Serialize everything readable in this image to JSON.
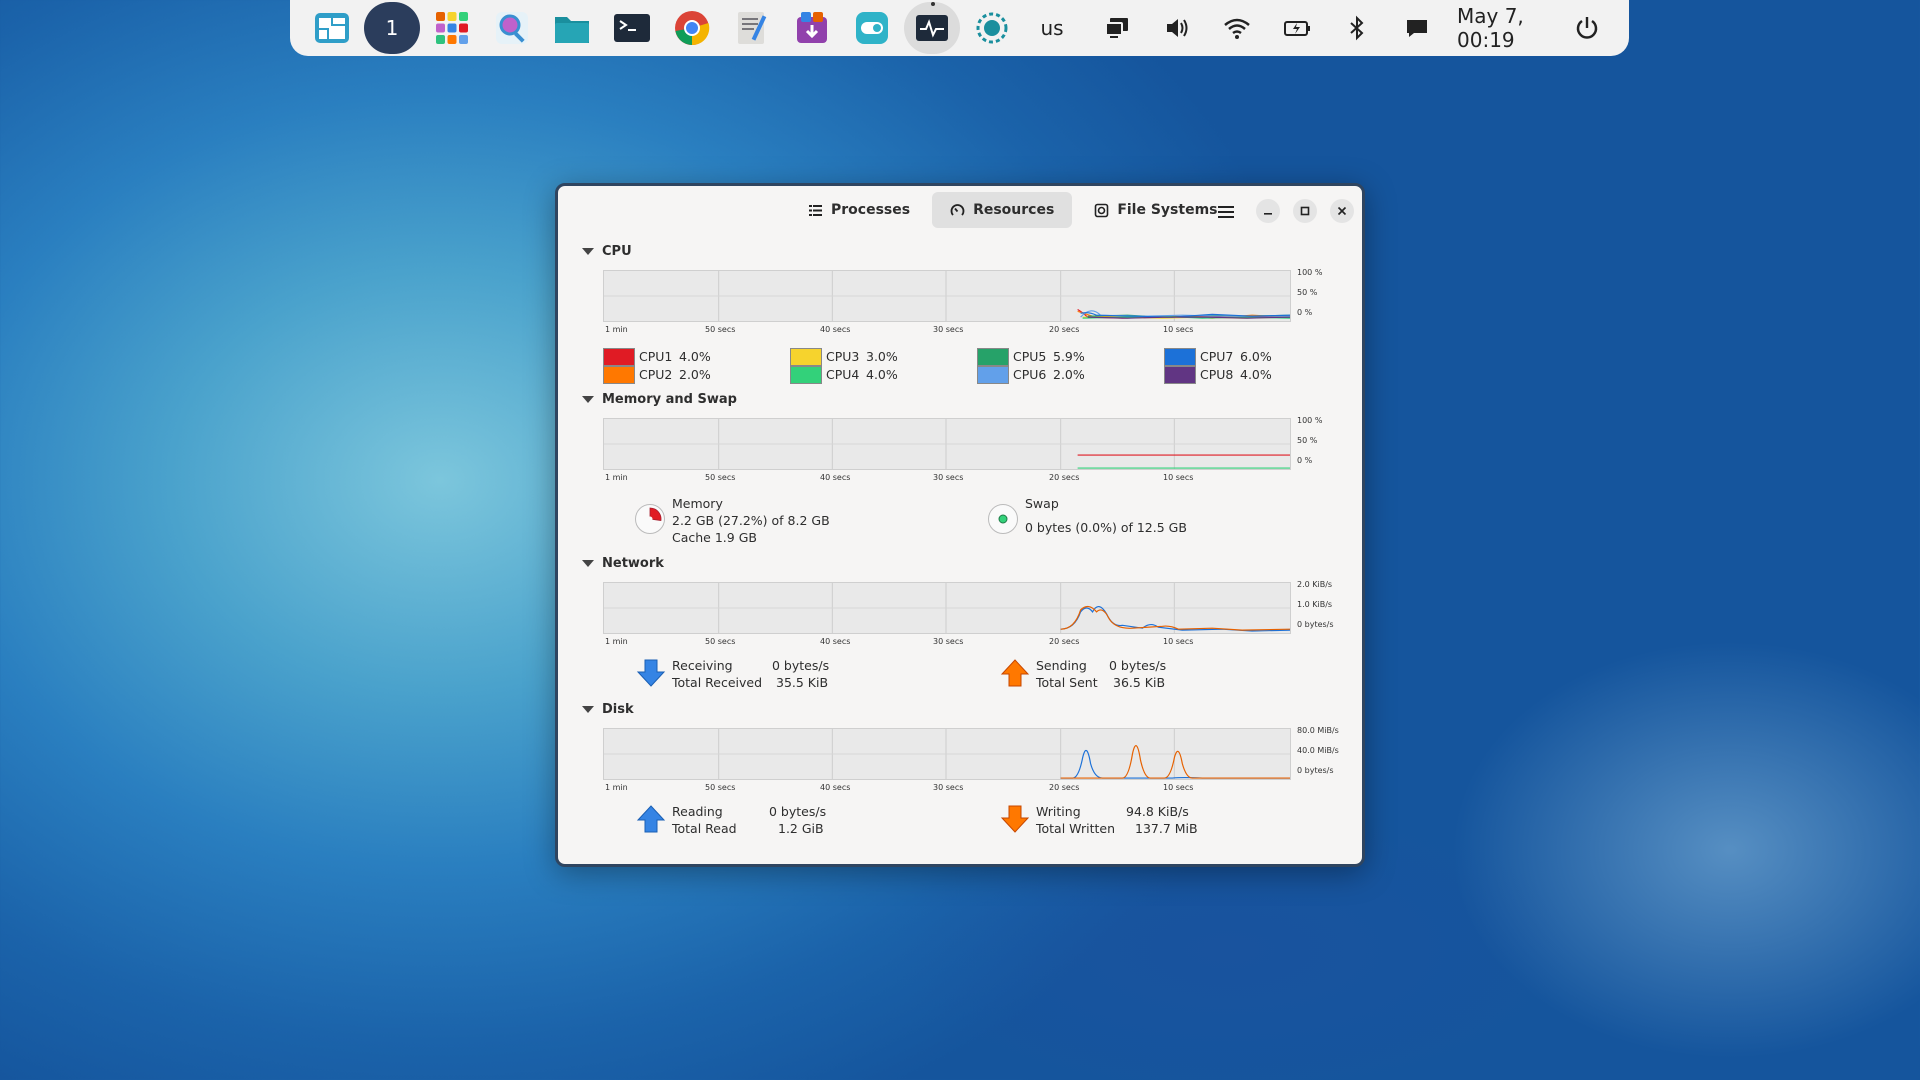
{
  "dock": {
    "workspace": "1",
    "keyboard_layout": "us",
    "datetime": "May 7, 00:19",
    "apps": [
      "workspace-overview-icon",
      "app-grid-icon",
      "search-icon",
      "files-icon",
      "terminal-icon",
      "chrome-icon",
      "text-editor-icon",
      "software-store-icon",
      "toggle-icon",
      "system-monitor-icon",
      "recording-icon"
    ]
  },
  "window": {
    "tabs": [
      {
        "label": "Processes",
        "icon": "list-icon"
      },
      {
        "label": "Resources",
        "icon": "gauge-icon"
      },
      {
        "label": "File Systems",
        "icon": "disk-icon"
      }
    ],
    "active_tab": "Resources"
  },
  "graph_xlabels": [
    "1 min",
    "50 secs",
    "40 secs",
    "30 secs",
    "20 secs",
    "10 secs"
  ],
  "cpu": {
    "title": "CPU",
    "ylabels": [
      "100 %",
      "50 %",
      "0 %"
    ],
    "cores": [
      {
        "name": "CPU1",
        "value": "4.0%",
        "color": "#e01b24"
      },
      {
        "name": "CPU2",
        "value": "2.0%",
        "color": "#ff7800"
      },
      {
        "name": "CPU3",
        "value": "3.0%",
        "color": "#f6d32d"
      },
      {
        "name": "CPU4",
        "value": "4.0%",
        "color": "#33d17a"
      },
      {
        "name": "CPU5",
        "value": "5.9%",
        "color": "#26a269"
      },
      {
        "name": "CPU6",
        "value": "2.0%",
        "color": "#62a0ea"
      },
      {
        "name": "CPU7",
        "value": "6.0%",
        "color": "#1c71d8"
      },
      {
        "name": "CPU8",
        "value": "4.0%",
        "color": "#613583"
      }
    ]
  },
  "memory": {
    "title": "Memory and Swap",
    "ylabels": [
      "100 %",
      "50 %",
      "0 %"
    ],
    "mem_label": "Memory",
    "mem_value": "2.2 GB (27.2%) of 8.2 GB",
    "mem_cache": "Cache 1.9 GB",
    "mem_fraction": 0.272,
    "swap_label": "Swap",
    "swap_value": "0 bytes (0.0%) of 12.5 GB",
    "mem_color": "#e01b24",
    "swap_color": "#33d17a"
  },
  "network": {
    "title": "Network",
    "ylabels": [
      "2.0 KiB/s",
      "1.0 KiB/s",
      "0 bytes/s"
    ],
    "receiving_label": "Receiving",
    "receiving_value": "0 bytes/s",
    "total_received_label": "Total Received",
    "total_received_value": "35.5 KiB",
    "sending_label": "Sending",
    "sending_value": "0 bytes/s",
    "total_sent_label": "Total Sent",
    "total_sent_value": "36.5 KiB",
    "recv_color": "#1c71d8",
    "send_color": "#e66100"
  },
  "disk": {
    "title": "Disk",
    "ylabels": [
      "80.0 MiB/s",
      "40.0 MiB/s",
      "0 bytes/s"
    ],
    "reading_label": "Reading",
    "reading_value": "0 bytes/s",
    "total_read_label": "Total Read",
    "total_read_value": "1.2 GiB",
    "writing_label": "Writing",
    "writing_value": "94.8 KiB/s",
    "total_written_label": "Total Written",
    "total_written_value": "137.7 MiB",
    "read_color": "#1c71d8",
    "write_color": "#e66100"
  }
}
